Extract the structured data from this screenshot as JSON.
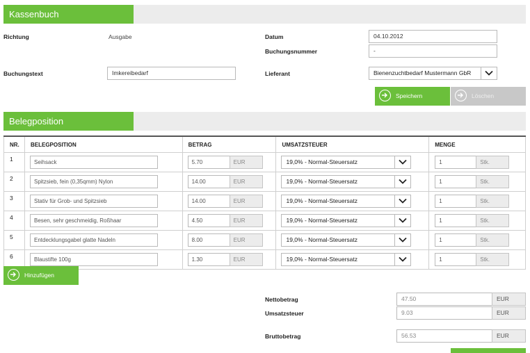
{
  "kassenbuch": {
    "title": "Kassenbuch"
  },
  "form": {
    "richtung_label": "Richtung",
    "richtung_value": "Ausgabe",
    "datum_label": "Datum",
    "datum_value": "04.10.2012",
    "buchungsnummer_label": "Buchungsnummer",
    "buchungsnummer_value": "-",
    "buchungstext_label": "Buchungstext",
    "buchungstext_value": "Imkereibedarf",
    "lieferant_label": "Lieferant",
    "lieferant_value": "Bienenzuchtbedarf Mustermann GbR"
  },
  "actions": {
    "save_label": "Speichern",
    "delete_label": "Löschen"
  },
  "belegposition": {
    "title": "Belegposition"
  },
  "table": {
    "headers": {
      "nr": "NR.",
      "beleg": "BELEGPOSITION",
      "betrag": "BETRAG",
      "ust": "UMSATZSTEUER",
      "menge": "MENGE"
    },
    "rows": [
      {
        "nr": "1",
        "beleg": "Seihsack",
        "betrag": "5.70",
        "currency": "EUR",
        "ust": "19,0% - Normal-Steuersatz",
        "menge": "1",
        "unit": "Stk."
      },
      {
        "nr": "2",
        "beleg": "Spitzsieb, fein (0,35qmm) Nylon",
        "betrag": "14.00",
        "currency": "EUR",
        "ust": "19,0% - Normal-Steuersatz",
        "menge": "1",
        "unit": "Stk."
      },
      {
        "nr": "3",
        "beleg": "Stativ für Grob- und Spitzsieb",
        "betrag": "14.00",
        "currency": "EUR",
        "ust": "19,0% - Normal-Steuersatz",
        "menge": "1",
        "unit": "Stk."
      },
      {
        "nr": "4",
        "beleg": "Besen, sehr geschmeidig, Roßhaar",
        "betrag": "4.50",
        "currency": "EUR",
        "ust": "19,0% - Normal-Steuersatz",
        "menge": "1",
        "unit": "Stk."
      },
      {
        "nr": "5",
        "beleg": "Entdecklungsgabel glatte Nadeln",
        "betrag": "8.00",
        "currency": "EUR",
        "ust": "19,0% - Normal-Steuersatz",
        "menge": "1",
        "unit": "Stk."
      },
      {
        "nr": "6",
        "beleg": "Blaustifte 100g",
        "betrag": "1.30",
        "currency": "EUR",
        "ust": "19,0% - Normal-Steuersatz",
        "menge": "1",
        "unit": "Stk."
      }
    ],
    "add_label": "Hinzufügen"
  },
  "summary": {
    "netto_label": "Nettobetrag",
    "netto_value": "47.50",
    "netto_currency": "EUR",
    "ust_label": "Umsatzsteuer",
    "ust_value": "9.03",
    "ust_currency": "EUR",
    "brutto_label": "Bruttobetrag",
    "brutto_value": "56.53",
    "brutto_currency": "EUR"
  },
  "colors": {
    "accent": "#6bbf3b",
    "header_bg": "#ececec",
    "disabled": "#c8c8c8"
  },
  "icons": {
    "button": "arrow-right-circle-icon",
    "dropdown": "chevron-down-icon"
  }
}
